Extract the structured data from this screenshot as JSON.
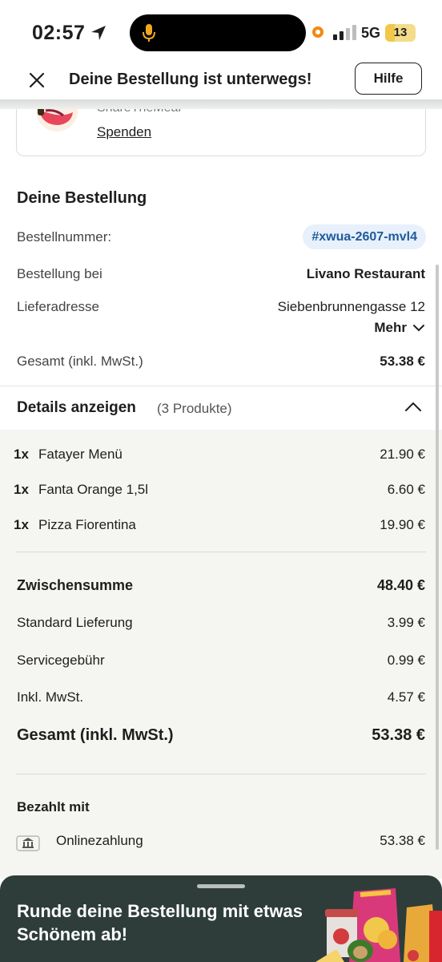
{
  "status_bar": {
    "time": "02:57",
    "network": "5G",
    "battery": "13",
    "battery_color": "#f2c84b",
    "recording_color": "#f08a13"
  },
  "nav": {
    "title": "Deine Bestellung ist unterwegs!",
    "help_label": "Hilfe",
    "close_icon": "close-icon"
  },
  "donation": {
    "name": "ShareTheMeal",
    "link_label": "Spenden"
  },
  "order": {
    "heading": "Deine Bestellung",
    "order_number_label": "Bestellnummer:",
    "order_number": "#xwua-2607-mvl4",
    "restaurant_label": "Bestellung bei",
    "restaurant": "Livano Restaurant",
    "address_label": "Lieferadresse",
    "address": "Siebenbrunnengasse 12",
    "more_label": "Mehr",
    "total_label": "Gesamt (inkl. MwSt.)",
    "total": "53.38 €"
  },
  "details": {
    "title": "Details anzeigen",
    "count": "(3 Produkte)",
    "items": [
      {
        "qty": "1x",
        "name": "Fatayer Menü",
        "price": "21.90 €"
      },
      {
        "qty": "1x",
        "name": "Fanta Orange 1,5l",
        "price": "6.60 €"
      },
      {
        "qty": "1x",
        "name": "Pizza Fiorentina",
        "price": "19.90 €"
      }
    ],
    "subtotal_label": "Zwischensumme",
    "subtotal": "48.40 €",
    "delivery_label": "Standard Lieferung",
    "delivery": "3.99 €",
    "service_label": "Servicegebühr",
    "service": "0.99 €",
    "vat_label": "Inkl. MwSt.",
    "vat": "4.57 €",
    "grand_total_label": "Gesamt (inkl. MwSt.)",
    "grand_total": "53.38 €",
    "paid_with_label": "Bezahlt mit",
    "payment_method": "Onlinezahlung",
    "payment_amount": "53.38 €"
  },
  "bottom_sheet": {
    "text": "Runde deine Bestellung mit etwas Schönem ab!",
    "background": "#2e3d3a"
  },
  "colors": {
    "accent_pill_bg": "#e7f0fb",
    "accent_pill_text": "#1f5a9b",
    "details_bg": "#f5f5f2"
  }
}
